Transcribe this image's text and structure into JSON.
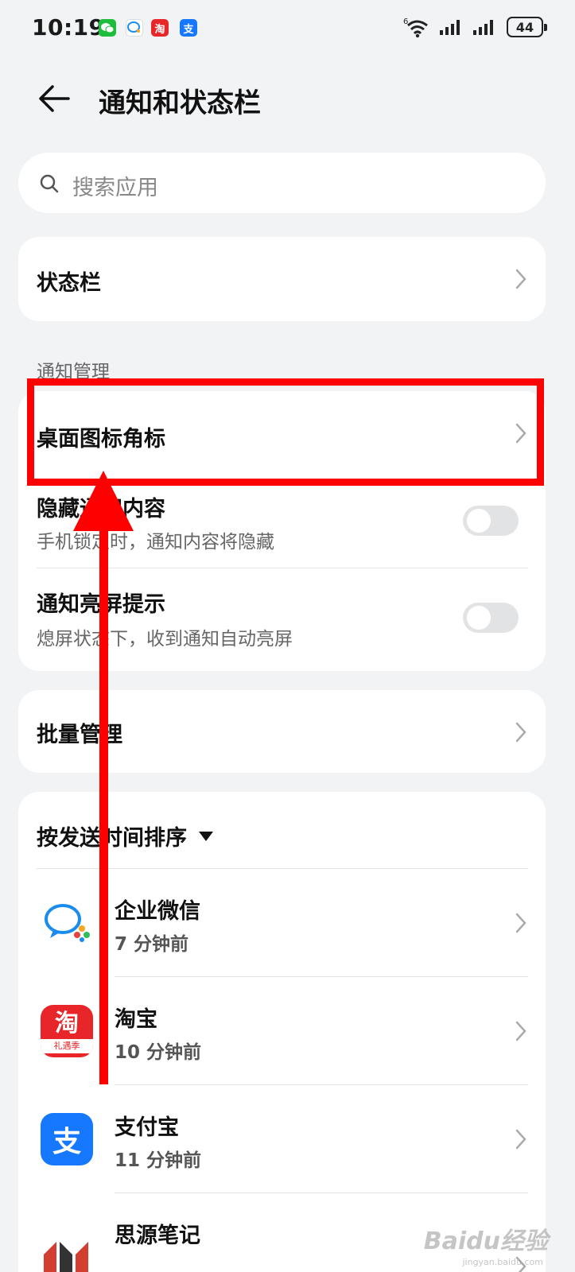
{
  "status_bar": {
    "time": "10:19",
    "battery": "44",
    "wifi_label": "6",
    "app_icons": [
      "wechat-icon",
      "wework-icon",
      "taobao-icon",
      "alipay-icon"
    ]
  },
  "header": {
    "title": "通知和状态栏"
  },
  "search": {
    "placeholder": "搜索应用"
  },
  "status_bar_row": {
    "label": "状态栏"
  },
  "notification_section": {
    "label": "通知管理",
    "badge_row": {
      "label": "桌面图标角标"
    },
    "hide_content": {
      "title": "隐藏通知内容",
      "subtitle": "手机锁定时，通知内容将隐藏",
      "enabled": false
    },
    "wake_screen": {
      "title": "通知亮屏提示",
      "subtitle": "熄屏状态下，收到通知自动亮屏",
      "enabled": false
    }
  },
  "batch_row": {
    "label": "批量管理"
  },
  "app_list": {
    "sort_label": "按发送时间排序",
    "apps": [
      {
        "name": "企业微信",
        "time": "7 分钟前",
        "icon": "wework-icon"
      },
      {
        "name": "淘宝",
        "time": "10 分钟前",
        "icon": "taobao-icon",
        "icon_text": "淘",
        "icon_sub": "礼遇季"
      },
      {
        "name": "支付宝",
        "time": "11 分钟前",
        "icon": "alipay-icon",
        "icon_text": "支"
      },
      {
        "name": "思源笔记",
        "time": "",
        "icon": "siyuan-icon"
      }
    ]
  },
  "annotation": {
    "color": "#ff0000"
  },
  "watermark": {
    "text": "Baidu经验",
    "sub": "jingyan.baidu.com"
  }
}
